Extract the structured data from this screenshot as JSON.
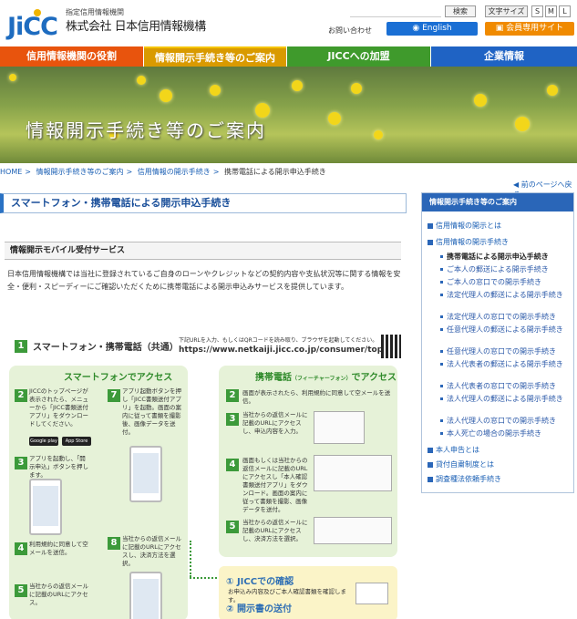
{
  "header": {
    "logo_text": "JiCC",
    "org_small": "指定信用情報機関",
    "org_name": "株式会社 日本信用情報機構",
    "search_button": "検索",
    "font_size_label": "文字サイズ",
    "font_sizes": [
      "S",
      "M",
      "L"
    ],
    "inquiry_link": "お問い合わせ",
    "english_button": "English",
    "member_button": "会員専用サイト"
  },
  "nav": {
    "items": [
      {
        "label": "信用情報機関の役割",
        "color": "#e8540d"
      },
      {
        "label": "情報開示手続き等のご案内",
        "color": "#e0a000"
      },
      {
        "label": "JICCへの加盟",
        "color": "#3f9a2c"
      },
      {
        "label": "企業情報",
        "color": "#1f63c4"
      }
    ]
  },
  "hero": {
    "title": "情報開示手続き等のご案内"
  },
  "breadcrumb": [
    "HOME",
    "情報開示手続き等のご案内",
    "信用情報の開示手続き",
    "携帯電話による開示申込手続き"
  ],
  "prev_link": "前のページへ戻る",
  "page_title": "スマートフォン・携帯電話による開示申込手続き",
  "section_heading": "情報開示モバイル受付サービス",
  "intro_text": "日本信用情報機構では当社に登録されているご自身のローンやクレジットなどの契約内容や支払状況等に関する情報を安全・便利・スピーディーにご確認いただくために携帯電話による開示申込みサービスを提供しています。",
  "sidebar": {
    "heading": "情報開示手続き等のご案内",
    "items": [
      {
        "label": "信用情報の開示とは",
        "level": 1
      },
      {
        "label": "信用情報の開示手続き",
        "level": 1
      },
      {
        "label": "携帯電話による開示申込手続き",
        "level": 2,
        "active": true
      },
      {
        "label": "ご本人の郵送による開示手続き",
        "level": 2
      },
      {
        "label": "ご本人の窓口での開示手続き",
        "level": 2
      },
      {
        "label": "法定代理人の郵送による開示手続き",
        "level": 2,
        "wrap": true
      },
      {
        "label": "法定代理人の窓口での開示手続き",
        "level": 2
      },
      {
        "label": "任意代理人の郵送による開示手続き",
        "level": 2,
        "wrap": true
      },
      {
        "label": "任意代理人の窓口での開示手続き",
        "level": 2
      },
      {
        "label": "法人代表者の郵送による開示手続き",
        "level": 2,
        "wrap": true
      },
      {
        "label": "法人代表者の窓口での開示手続き",
        "level": 2
      },
      {
        "label": "法人代理人の郵送による開示手続き",
        "level": 2,
        "wrap": true
      },
      {
        "label": "法人代理人の窓口での開示手続き",
        "level": 2
      },
      {
        "label": "本人死亡の場合の開示手続き",
        "level": 2
      },
      {
        "label": "本人申告とは",
        "level": 1
      },
      {
        "label": "貸付自粛制度とは",
        "level": 1
      },
      {
        "label": "調査種法依頼手続き",
        "level": 1
      }
    ]
  },
  "flow": {
    "step1_title": "スマートフォン・携帯電話（共通）",
    "step1_note": "下記URLを入力、もしくはQRコードを読み取り、ブラウザを起動してください。",
    "url": "https://www.netkaiji.jicc.co.jp/consumer/top.do",
    "smart_title": "スマートフォンでアクセス",
    "feat_title_main": "携帯電話",
    "feat_title_sub": "（フィーチャーフォン）",
    "feat_title_end": "でアクセス",
    "steps_smart": [
      {
        "num": "2",
        "text": "JICCのトップページが表示されたら、メニューから「JICC書類送付アプリ」をダウンロードしてください。"
      },
      {
        "num": "7",
        "text": "アプリ起動ボタンを押し「JICC書類送付アプリ」を起動。画面の案内に従って書類を撮影後、画像データを送付。"
      },
      {
        "num": "3",
        "text": "アプリを起動し、「開示申込」ボタンを押します。"
      },
      {
        "num": "4",
        "text": "利用規約に同意して空メールを送信。"
      },
      {
        "num": "8",
        "text": "当社からの返信メールに記載のURLにアクセスし、決済方法を選択。"
      },
      {
        "num": "5",
        "text": "当社からの返信メールに記載のURLにアクセス。"
      }
    ],
    "steps_feat": [
      {
        "num": "2",
        "text": "画面が表示されたら、利用規約に同意して空メールを送信。"
      },
      {
        "num": "3",
        "text": "当社からの返信メールに記載のURLにアクセスし、申込内容を入力。"
      },
      {
        "num": "4",
        "text": "画面もしくは当社からの返信メールに記載のURLにアクセスし「本人確認書類送付アプリ」をダウンロード。画面の案内に従って書類を撮影、画像データを送付。"
      },
      {
        "num": "5",
        "text": "当社からの返信メールに記載のURLにアクセスし、決済方法を選択。"
      }
    ],
    "confirm_1": "① JICCでの確認",
    "confirm_1_text": "お申込み内容及びご本人確認書類を確認します。",
    "confirm_2": "② 開示書の送付",
    "badge_google": "Google play",
    "badge_apple": "App Store"
  }
}
